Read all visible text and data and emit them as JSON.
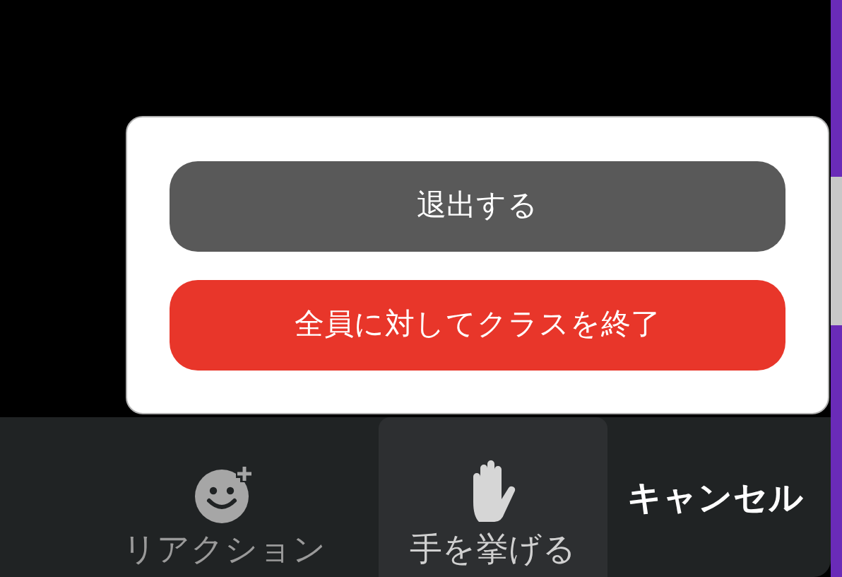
{
  "popup": {
    "buttons": [
      {
        "label": "退出する",
        "kind": "secondary"
      },
      {
        "label": "全員に対してクラスを終了",
        "kind": "danger"
      }
    ]
  },
  "toolbar": {
    "items": [
      {
        "label": "リアクション",
        "kind": "reaction",
        "selected": false
      },
      {
        "label": "手を挙げる",
        "kind": "raise-hand",
        "selected": true
      }
    ],
    "cancel": "キャンセル"
  }
}
